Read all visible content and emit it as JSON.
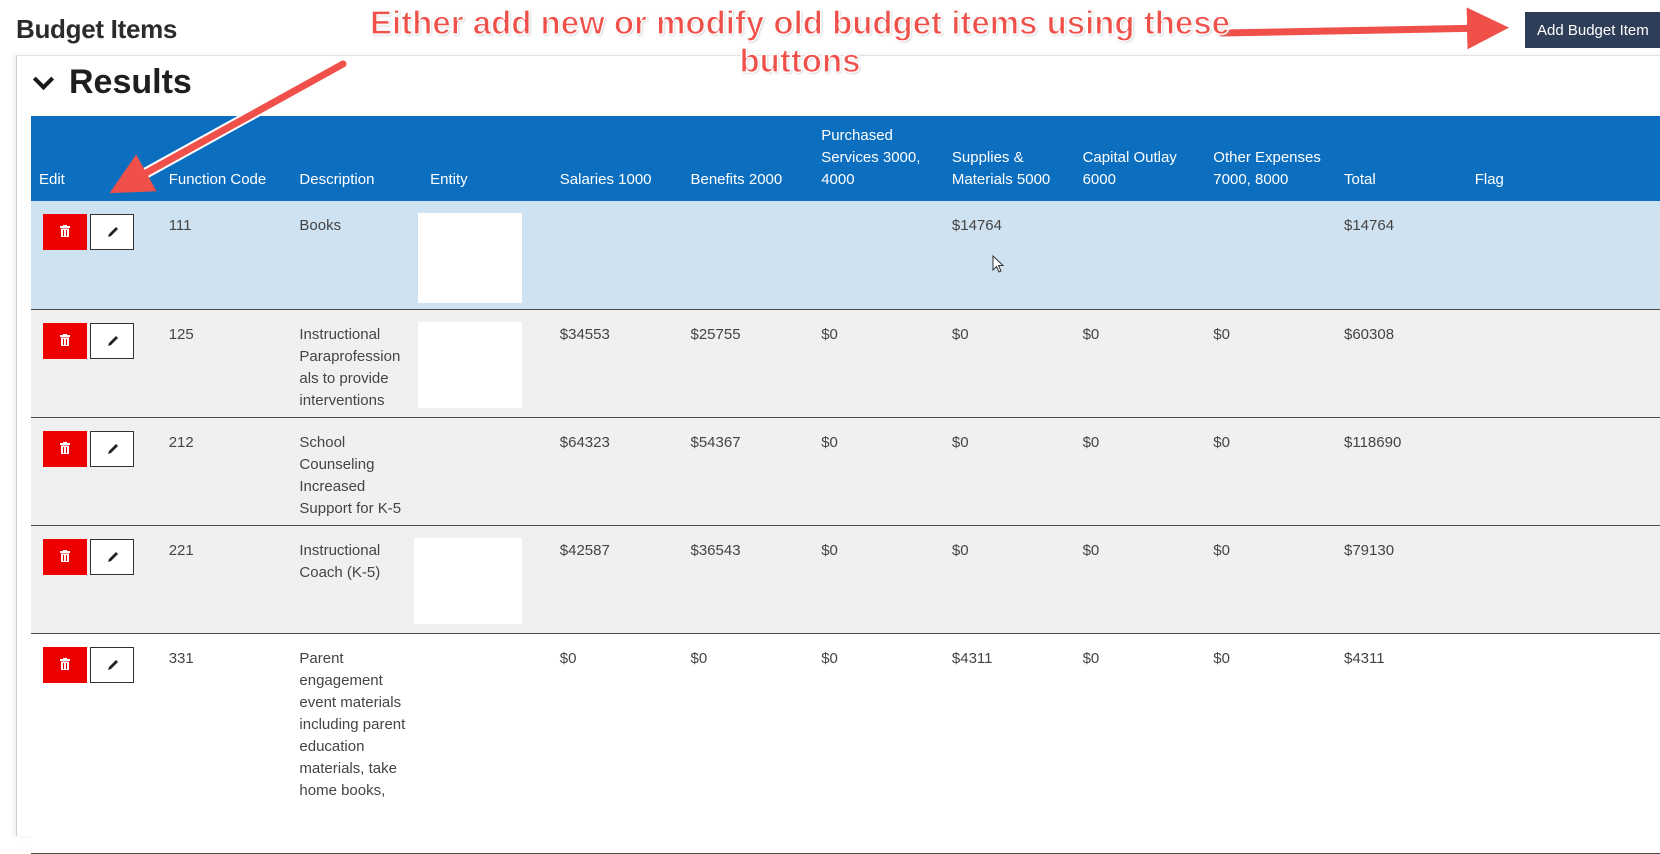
{
  "page": {
    "title": "Budget Items",
    "add_button_label": "Add Budget Item"
  },
  "annotation": {
    "text": "Either add new or modify old budget items using these buttons",
    "color": "#f0504a"
  },
  "results": {
    "title": "Results",
    "expanded": true
  },
  "table": {
    "columns": [
      "Edit",
      "Function Code",
      "Description",
      "Entity",
      "Salaries 1000",
      "Benefits 2000",
      "Purchased Services 3000, 4000",
      "Supplies & Materials 5000",
      "Capital Outlay 6000",
      "Other Expenses 7000, 8000",
      "Total",
      "Flag"
    ],
    "rows": [
      {
        "function_code": "111",
        "description": "Books",
        "entity": "",
        "salaries": "",
        "benefits": "",
        "purchased": "",
        "supplies": "$14764",
        "capital": "",
        "other": "",
        "total": "$14764",
        "flag": "",
        "highlighted": true
      },
      {
        "function_code": "125",
        "description": "Instructional Paraprofession als to provide interventions",
        "entity": "",
        "salaries": "$34553",
        "benefits": "$25755",
        "purchased": "$0",
        "supplies": "$0",
        "capital": "$0",
        "other": "$0",
        "total": "$60308",
        "flag": ""
      },
      {
        "function_code": "212",
        "description": "School Counseling Increased Support for K-5",
        "entity": "",
        "salaries": "$64323",
        "benefits": "$54367",
        "purchased": "$0",
        "supplies": "$0",
        "capital": "$0",
        "other": "$0",
        "total": "$118690",
        "flag": ""
      },
      {
        "function_code": "221",
        "description": "Instructional Coach (K-5)",
        "entity": "",
        "salaries": "$42587",
        "benefits": "$36543",
        "purchased": "$0",
        "supplies": "$0",
        "capital": "$0",
        "other": "$0",
        "total": "$79130",
        "flag": ""
      },
      {
        "function_code": "331",
        "description": "Parent engagement event materials including parent education materials, take home books,",
        "entity": "",
        "salaries": "$0",
        "benefits": "$0",
        "purchased": "$0",
        "supplies": "$4311",
        "capital": "$0",
        "other": "$0",
        "total": "$4311",
        "flag": ""
      }
    ]
  },
  "icons": {
    "delete": "trash-icon",
    "edit": "pencil-icon",
    "collapse": "chevron-down-icon"
  },
  "colors": {
    "header_bg": "#0b6ebf",
    "delete_button": "#ee0000",
    "add_button": "#2f3e58",
    "selected_row": "#cfe2f1",
    "row": "#f0f0f0"
  }
}
